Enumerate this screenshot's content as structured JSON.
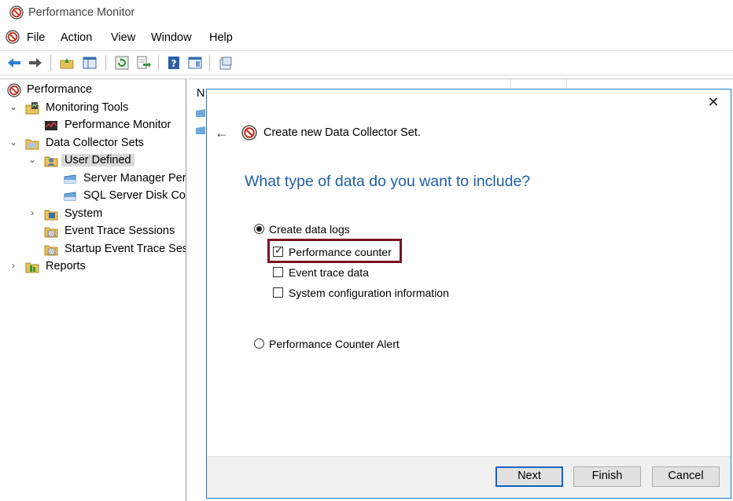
{
  "window": {
    "title": "Performance Monitor"
  },
  "menu": {
    "items": [
      "File",
      "Action",
      "View",
      "Window",
      "Help"
    ]
  },
  "toolbar": {
    "buttons": [
      "back-arrow-icon",
      "forward-arrow-icon",
      "up-folder-icon",
      "show-hide-tree-icon",
      "refresh-icon",
      "export-list-icon",
      "help-icon",
      "properties-icon",
      "new-window-icon"
    ]
  },
  "tree": {
    "items": [
      {
        "label": "Performance",
        "icon": "performance-icon"
      },
      {
        "label": "Monitoring Tools",
        "icon": "monitoring-tools-icon"
      },
      {
        "label": "Performance Monitor",
        "icon": "performance-monitor-icon"
      },
      {
        "label": "Data Collector Sets",
        "icon": "folder-icon"
      },
      {
        "label": "User Defined",
        "icon": "user-defined-icon"
      },
      {
        "label": "Server Manager Per",
        "icon": "collector-set-icon"
      },
      {
        "label": "SQL Server Disk Cou",
        "icon": "collector-set-icon"
      },
      {
        "label": "System",
        "icon": "system-icon"
      },
      {
        "label": "Event Trace Sessions",
        "icon": "event-trace-icon"
      },
      {
        "label": "Startup Event Trace Ses",
        "icon": "startup-trace-icon"
      },
      {
        "label": "Reports",
        "icon": "reports-icon"
      }
    ]
  },
  "list": {
    "header": "N"
  },
  "dialog": {
    "title": "Create new Data Collector Set.",
    "question": "What type of data do you want to include?",
    "options": {
      "create_data_logs": {
        "label": "Create data logs",
        "selected": true
      },
      "performance_counter": {
        "label": "Performance counter",
        "checked": true
      },
      "event_trace_data": {
        "label": "Event trace data",
        "checked": false
      },
      "system_config": {
        "label": "System configuration information",
        "checked": false
      },
      "performance_counter_alert": {
        "label": "Performance Counter Alert",
        "selected": false
      }
    },
    "buttons": {
      "next": "Next",
      "finish": "Finish",
      "cancel": "Cancel"
    },
    "highlight_color": "#7b1122",
    "accent_color": "#1e5fa8"
  }
}
